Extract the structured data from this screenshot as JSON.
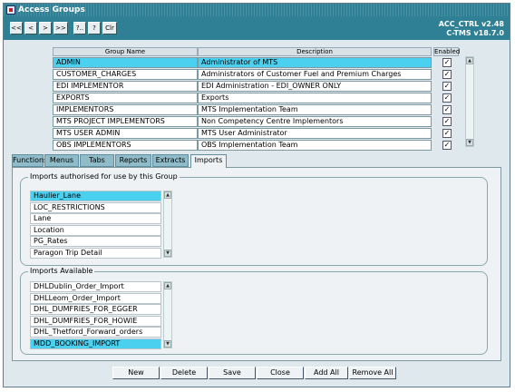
{
  "window": {
    "title": "Access Groups"
  },
  "toolbar": {
    "buttons": [
      "<<",
      "<",
      ">",
      ">>",
      "?..",
      "?",
      "Clr"
    ]
  },
  "app": {
    "code": "ACC_CTRL v2.48",
    "product": "C-TMS v18.7.0"
  },
  "grid": {
    "headers": {
      "name": "Group Name",
      "desc": "Description",
      "enabled": "Enabled"
    },
    "rows": [
      {
        "name": "ADMIN",
        "desc": "Administrator of MTS",
        "enabled": "✓",
        "selected": true
      },
      {
        "name": "CUSTOMER_CHARGES",
        "desc": "Administrators of Customer Fuel and Premium Charges",
        "enabled": "✓"
      },
      {
        "name": "EDI IMPLEMENTOR",
        "desc": "EDI Administration - EDI_OWNER ONLY",
        "enabled": "✓"
      },
      {
        "name": "EXPORTS",
        "desc": "Exports",
        "enabled": "✓"
      },
      {
        "name": "IMPLEMENTORS",
        "desc": "MTS Implementation Team",
        "enabled": "✓"
      },
      {
        "name": "MTS PROJECT IMPLEMENTORS",
        "desc": "Non Competency Centre Implementors",
        "enabled": "✓"
      },
      {
        "name": "MTS USER ADMIN",
        "desc": "MTS User Administrator",
        "enabled": "✓"
      },
      {
        "name": "OBS IMPLEMENTORS",
        "desc": "OBS Implementation Team",
        "enabled": "✓"
      }
    ]
  },
  "tabs": [
    "Functions",
    "Menus",
    "Tabs",
    "Reports",
    "Extracts",
    "Imports"
  ],
  "active_tab": "Imports",
  "authorised": {
    "title": "Imports authorised for use by this Group",
    "items": [
      "Haulier_Lane",
      "LOC_RESTRICTIONS",
      "Lane",
      "Location",
      "PG_Rates",
      "Paragon Trip Detail"
    ]
  },
  "available": {
    "title": "Imports Available",
    "items": [
      "DHLDublin_Order_Import",
      "DHLLeom_Order_Import",
      "DHL_DUMFRIES_FOR_EGGER",
      "DHL_DUMFRIES_FOR_HOWIE",
      "DHL_Thetford_Forward_orders",
      "MDD_BOOKING_IMPORT"
    ]
  },
  "buttons": {
    "new": "New",
    "delete": "Delete",
    "save": "Save",
    "close": "Close",
    "add_all": "Add All",
    "remove_all": "Remove All"
  },
  "colors": {
    "titlebar": "#2f7f95",
    "selection": "#4cd0f0",
    "tab": "#8fbcc8"
  }
}
